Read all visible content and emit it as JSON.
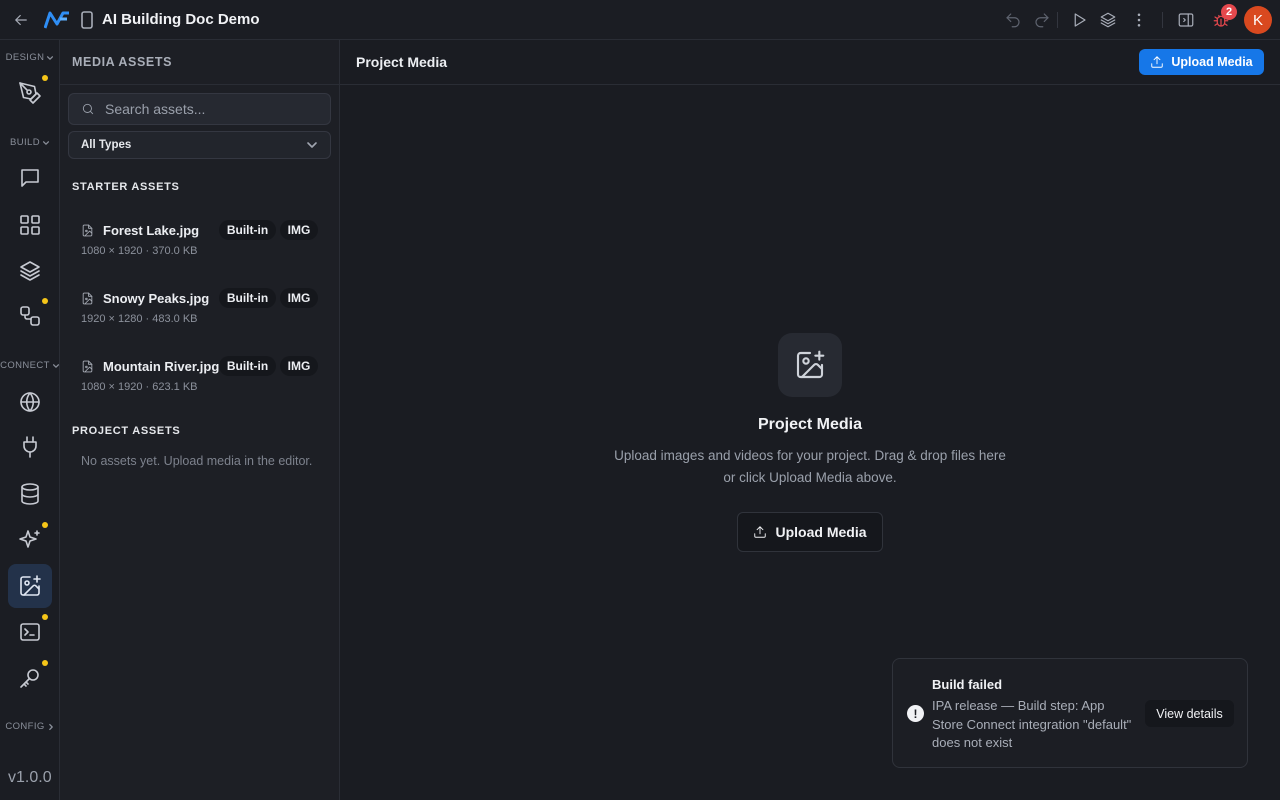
{
  "app": {
    "title": "AI Building Doc Demo",
    "bug_count": "2",
    "avatar_initial": "K",
    "version": "v1.0.0",
    "accent": "#1677e8",
    "error_color": "#e5484d"
  },
  "rail": {
    "sections": {
      "design": "DESIGN",
      "build": "BUILD",
      "connect": "CONNECT",
      "config": "CONFIG"
    },
    "items": [
      {
        "icon": "pen-tool-icon",
        "dot": true
      },
      {
        "icon": "chat-icon",
        "dot": false
      },
      {
        "icon": "grid-icon",
        "dot": false
      },
      {
        "icon": "layers-icon",
        "dot": false
      },
      {
        "icon": "workflow-icon",
        "dot": true
      },
      {
        "icon": "globe-icon",
        "dot": false
      },
      {
        "icon": "plug-icon",
        "dot": false
      },
      {
        "icon": "database-icon",
        "dot": false
      },
      {
        "icon": "sparkles-icon",
        "dot": true
      },
      {
        "icon": "image-plus-icon",
        "dot": false,
        "active": true
      },
      {
        "icon": "terminal-icon",
        "dot": true
      },
      {
        "icon": "key-icon",
        "dot": true
      }
    ]
  },
  "sidebar": {
    "heading": "MEDIA ASSETS",
    "search_placeholder": "Search assets...",
    "type_filter": "All Types",
    "starter_heading": "STARTER ASSETS",
    "starter_assets": [
      {
        "name": "Forest Lake.jpg",
        "badge": "Built-in",
        "kind": "IMG",
        "meta": "1080 × 1920 · 370.0 KB"
      },
      {
        "name": "Snowy Peaks.jpg",
        "badge": "Built-in",
        "kind": "IMG",
        "meta": "1920 × 1280 · 483.0 KB"
      },
      {
        "name": "Mountain River.jpg",
        "badge": "Built-in",
        "kind": "IMG",
        "meta": "1080 × 1920 · 623.1 KB"
      }
    ],
    "project_heading": "PROJECT ASSETS",
    "project_empty": "No assets yet. Upload media in the editor."
  },
  "main": {
    "title": "Project Media",
    "upload_label": "Upload Media",
    "empty_title": "Project Media",
    "empty_desc": "Upload images and videos for your project. Drag & drop files here or click Upload Media above.",
    "empty_upload_label": "Upload Media"
  },
  "toast": {
    "title": "Build failed",
    "message": "IPA release — Build step: App Store Connect integration \"default\" does not exist",
    "action": "View details"
  }
}
